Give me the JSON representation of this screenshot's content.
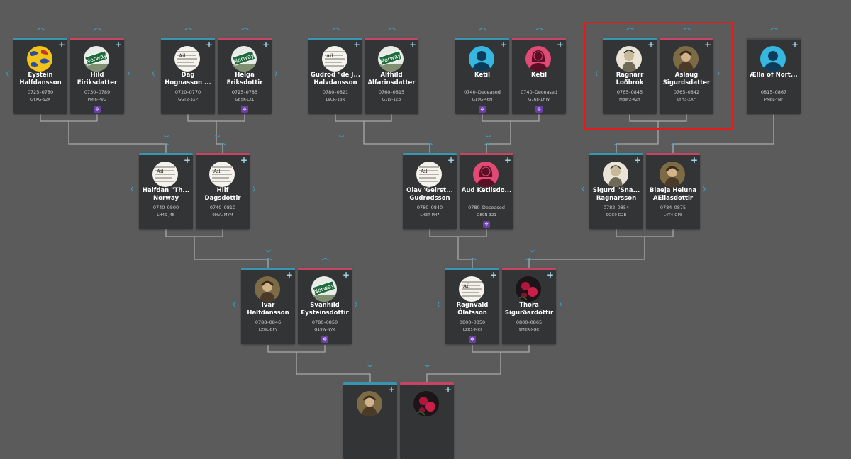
{
  "icons": {
    "plus": "+",
    "up": "^",
    "down": "⌄",
    "left": "‹",
    "right": "›",
    "tree_badge": "✲"
  },
  "colors": {
    "background": "#5b5b5b",
    "card": "#333436",
    "male_accent": "#3796b4",
    "female_accent": "#c74465",
    "arrow": "#35a6cc",
    "badge": "#6a3fa8",
    "highlight": "#e21b1b"
  },
  "people": [
    {
      "name_line1": "Eystein",
      "name_line2": "Halfdansson",
      "dates": "0725–0780",
      "id": "GYXG-S2X",
      "gender": "male",
      "avatar": "crest-icon",
      "badge": false
    },
    {
      "name_line1": "Hild",
      "name_line2": "Eiriksdatter",
      "dates": "0730–0789",
      "id": "PMJ6-PVG",
      "gender": "female",
      "avatar": "norway-sign-icon",
      "badge": true
    },
    {
      "name_line1": "Dag",
      "name_line2": "Hognasson ...",
      "dates": "0720–0770",
      "id": "GGT2-3XP",
      "gender": "male",
      "avatar": "manuscript-icon",
      "badge": false
    },
    {
      "name_line1": "Helga",
      "name_line2": "Eriksdottir",
      "dates": "0725–0785",
      "id": "GB5K-LX1",
      "gender": "female",
      "avatar": "norway-sign-icon",
      "badge": true
    },
    {
      "name_line1": "Gudrod \"de J...",
      "name_line2": "Halvdansson",
      "dates": "0780–0821",
      "id": "LVCR-13R",
      "gender": "male",
      "avatar": "manuscript-icon",
      "badge": false
    },
    {
      "name_line1": "Alfhild",
      "name_line2": "Alfarinsdatter",
      "dates": "0760–0815",
      "id": "G1LV-1Z3",
      "gender": "female",
      "avatar": "norway-sign-icon",
      "badge": false
    },
    {
      "name_line1": "Ketil",
      "name_line2": "",
      "dates": "0740–Deceased",
      "id": "G19G-46H",
      "gender": "male",
      "avatar": "male-silhouette-icon",
      "badge": true
    },
    {
      "name_line1": "Ketil",
      "name_line2": "",
      "dates": "0740–Deceased",
      "id": "G168-1HW",
      "gender": "female",
      "avatar": "female-silhouette-icon",
      "badge": true
    },
    {
      "name_line1": "Ragnarr",
      "name_line2": "Loðbrók",
      "dates": "0765–0845",
      "id": "M8W2-XZY",
      "gender": "male",
      "avatar": "portrait-sketch-icon",
      "badge": false
    },
    {
      "name_line1": "Aslaug",
      "name_line2": "Sigurdsdatter",
      "dates": "0765–0842",
      "id": "LYH3-ZXF",
      "gender": "female",
      "avatar": "painted-portrait-icon",
      "badge": false
    },
    {
      "name_line1": "Ælla of Nort...",
      "name_line2": "",
      "dates": "0815–0867",
      "id": "PM8L-YNF",
      "gender": "unknown",
      "avatar": "male-silhouette-icon",
      "badge": false
    },
    {
      "name_line1": "Halfdan \"Th...",
      "name_line2": "Norway",
      "dates": "0740–0800",
      "id": "LH4S-J4B",
      "gender": "male",
      "avatar": "manuscript-icon",
      "badge": false
    },
    {
      "name_line1": "Hilf",
      "name_line2": "Dagsdottir",
      "dates": "0740–0810",
      "id": "9HVL-MYM",
      "gender": "female",
      "avatar": "manuscript-icon",
      "badge": false
    },
    {
      "name_line1": "Olav 'Geirst...",
      "name_line2": "Gudrødsson",
      "dates": "0780–0840",
      "id": "LH3R-PH7",
      "gender": "male",
      "avatar": "manuscript-icon",
      "badge": false
    },
    {
      "name_line1": "Aud Ketilsdo...",
      "name_line2": "",
      "dates": "0780–Deceased",
      "id": "G89N-321",
      "gender": "female",
      "avatar": "female-silhouette-icon",
      "badge": true
    },
    {
      "name_line1": "Sigurd \"Sna...",
      "name_line2": "Ragnarsson",
      "dates": "0782–0854",
      "id": "9QC9-D2B",
      "gender": "male",
      "avatar": "portrait-sketch-icon",
      "badge": false
    },
    {
      "name_line1": "Blaeja Heluna",
      "name_line2": "AEllasdottir",
      "dates": "0784–0875",
      "id": "L4T4-GP8",
      "gender": "female",
      "avatar": "painted-portrait-icon",
      "badge": false
    },
    {
      "name_line1": "Ivar",
      "name_line2": "Halfdansson",
      "dates": "0788–0846",
      "id": "LZGL-BFY",
      "gender": "male",
      "avatar": "painted-portrait-icon",
      "badge": false
    },
    {
      "name_line1": "Svanhild",
      "name_line2": "Eysteinsdottir",
      "dates": "0780–0850",
      "id": "G19W-NYK",
      "gender": "female",
      "avatar": "norway-sign-icon",
      "badge": true
    },
    {
      "name_line1": "Ragnvald",
      "name_line2": "Ólafsson",
      "dates": "0800–0850",
      "id": "LZK1-MCJ",
      "gender": "male",
      "avatar": "manuscript-icon",
      "badge": true
    },
    {
      "name_line1": "Thora",
      "name_line2": "Sigurðardóttir",
      "dates": "0800–0865",
      "id": "9M2R-XGC",
      "gender": "female",
      "avatar": "roses-icon",
      "badge": false
    },
    {
      "name_line1": "",
      "name_line2": "",
      "dates": "",
      "id": "",
      "gender": "male",
      "avatar": "painted-portrait-icon",
      "badge": false
    },
    {
      "name_line1": "",
      "name_line2": "",
      "dates": "",
      "id": "",
      "gender": "female",
      "avatar": "roses-icon",
      "badge": false
    }
  ]
}
